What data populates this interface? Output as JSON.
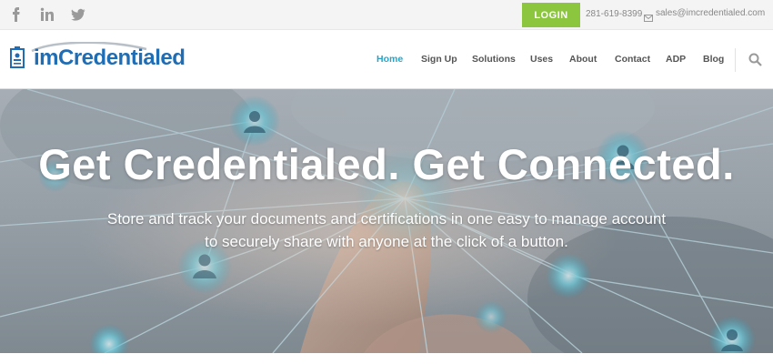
{
  "topbar": {
    "social_icons": [
      "facebook-icon",
      "linkedin-icon",
      "twitter-icon"
    ],
    "login_label": "LOGIN",
    "phone": "281-619-8399",
    "email": "sales@imcredentialed.com"
  },
  "header": {
    "logo_text": "imCredentialed",
    "nav": [
      {
        "label": "Home",
        "active": true
      },
      {
        "label": "Sign Up"
      },
      {
        "label": "Solutions"
      },
      {
        "label": "Uses"
      },
      {
        "label": "About"
      },
      {
        "label": "Contact"
      },
      {
        "label": "ADP"
      },
      {
        "label": "Blog"
      }
    ]
  },
  "hero": {
    "title": "Get Credentialed. Get Connected.",
    "subtitle_line1": "Store and track your documents and certifications in one easy to manage account",
    "subtitle_line2": "to securely share with anyone at the click of a button."
  },
  "colors": {
    "accent": "#2aa4c6",
    "login": "#8cc63f",
    "logo": "#1f6db5"
  }
}
